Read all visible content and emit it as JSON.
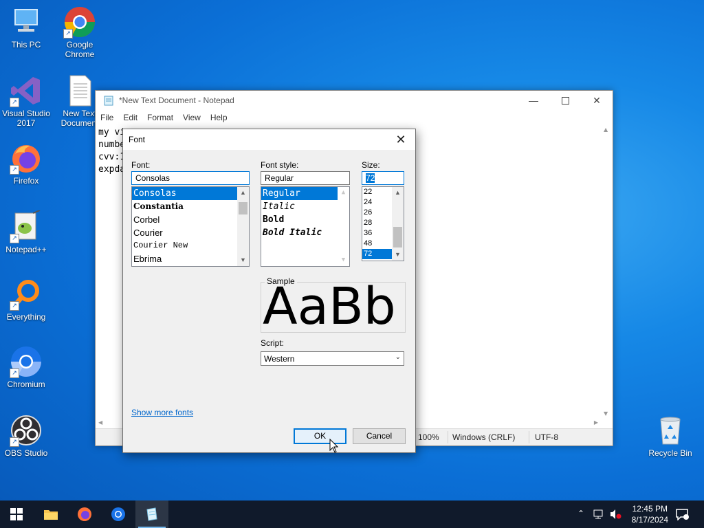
{
  "desktop": {
    "icons": [
      {
        "label": "This PC"
      },
      {
        "label": "Google Chrome"
      },
      {
        "label": "Visual Studio 2017"
      },
      {
        "label": "New Text Document"
      },
      {
        "label": "Firefox"
      },
      {
        "label": "Notepad++"
      },
      {
        "label": "Everything"
      },
      {
        "label": "Chromium"
      },
      {
        "label": "OBS Studio"
      },
      {
        "label": "Recycle Bin"
      }
    ]
  },
  "notepad": {
    "title": "*New Text Document - Notepad",
    "menu": [
      "File",
      "Edit",
      "Format",
      "View",
      "Help"
    ],
    "lines": [
      "my vi",
      "numbe",
      "cvv:1",
      "expda"
    ],
    "status": {
      "zoom": "100%",
      "line_ending": "Windows (CRLF)",
      "encoding": "UTF-8"
    }
  },
  "font_dialog": {
    "title": "Font",
    "font_label": "Font:",
    "font_value": "Consolas",
    "fonts": [
      "Consolas",
      "Constantia",
      "Corbel",
      "Courier",
      "Courier New",
      "Ebrima"
    ],
    "style_label": "Font style:",
    "style_value": "Regular",
    "styles": [
      "Regular",
      "Italic",
      "Bold",
      "Bold Italic"
    ],
    "size_label": "Size:",
    "size_value": "72",
    "sizes": [
      "22",
      "24",
      "26",
      "28",
      "36",
      "48",
      "72"
    ],
    "sample_label": "Sample",
    "sample_text": "AaBb",
    "script_label": "Script:",
    "script_value": "Western",
    "show_more": "Show more fonts",
    "ok": "OK",
    "cancel": "Cancel",
    "accent": "#0078d7"
  },
  "taskbar": {
    "time": "12:45 PM",
    "date": "8/17/2024"
  }
}
